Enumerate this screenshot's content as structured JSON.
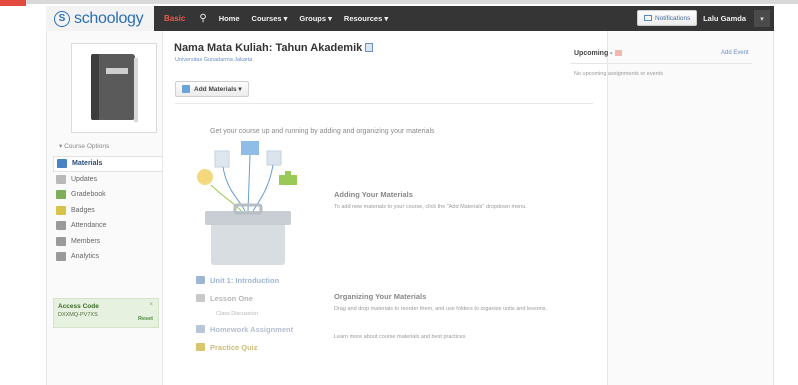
{
  "nav": {
    "logo": "schoology",
    "logo_mark": "S",
    "basic": "Basic",
    "items": [
      "Home",
      "Courses ▾",
      "Groups ▾",
      "Resources ▾"
    ],
    "user": "Lalu Gamda",
    "caret": "▾"
  },
  "course": {
    "title": "Nama Mata Kuliah: Tahun Akademik",
    "subtitle": "Universitas Gunadarma Jakarta"
  },
  "sidebar": {
    "options": "▾  Course Options",
    "items": [
      {
        "label": "Materials",
        "color": "#4a83c4"
      },
      {
        "label": "Updates",
        "color": "#b9b9b9"
      },
      {
        "label": "Gradebook",
        "color": "#7fae5a"
      },
      {
        "label": "Badges",
        "color": "#d8c24a"
      },
      {
        "label": "Attendance",
        "color": "#9a9a9a"
      },
      {
        "label": "Members",
        "color": "#9a9a9a"
      },
      {
        "label": "Analytics",
        "color": "#9a9a9a"
      }
    ],
    "access": {
      "title": "Access Code",
      "code": "DXXMQ-PV7XS",
      "reset": "Reset",
      "close": "×"
    }
  },
  "main": {
    "add_materials": "Add Materials ▾",
    "intro": "Get your course up and running by adding and organizing your materials",
    "adding_head": "Adding Your Materials",
    "adding_desc": "To add new materials to your course, click the \"Add Materials\" dropdown menu.",
    "outline": [
      {
        "label": "Unit 1: Introduction",
        "color": "#9fb6d4"
      },
      {
        "label": "Lesson One",
        "color": "#c9c9c9"
      },
      {
        "label": "Homework Assignment",
        "color": "#b8c6d8"
      },
      {
        "label": "Practice Quiz",
        "color": "#d7c66a"
      }
    ],
    "outline_sub": "Class Discussion",
    "org_head": "Organizing Your Materials",
    "org_desc": "Drag and drop materials to reorder them, and use folders to organize units and lessons.",
    "org_learn": "Learn more about course materials and best practices"
  },
  "right": {
    "notifications": "Notifications",
    "upcoming": "Upcoming -",
    "add_event": "Add Event",
    "empty": "No upcoming assignments or events"
  }
}
